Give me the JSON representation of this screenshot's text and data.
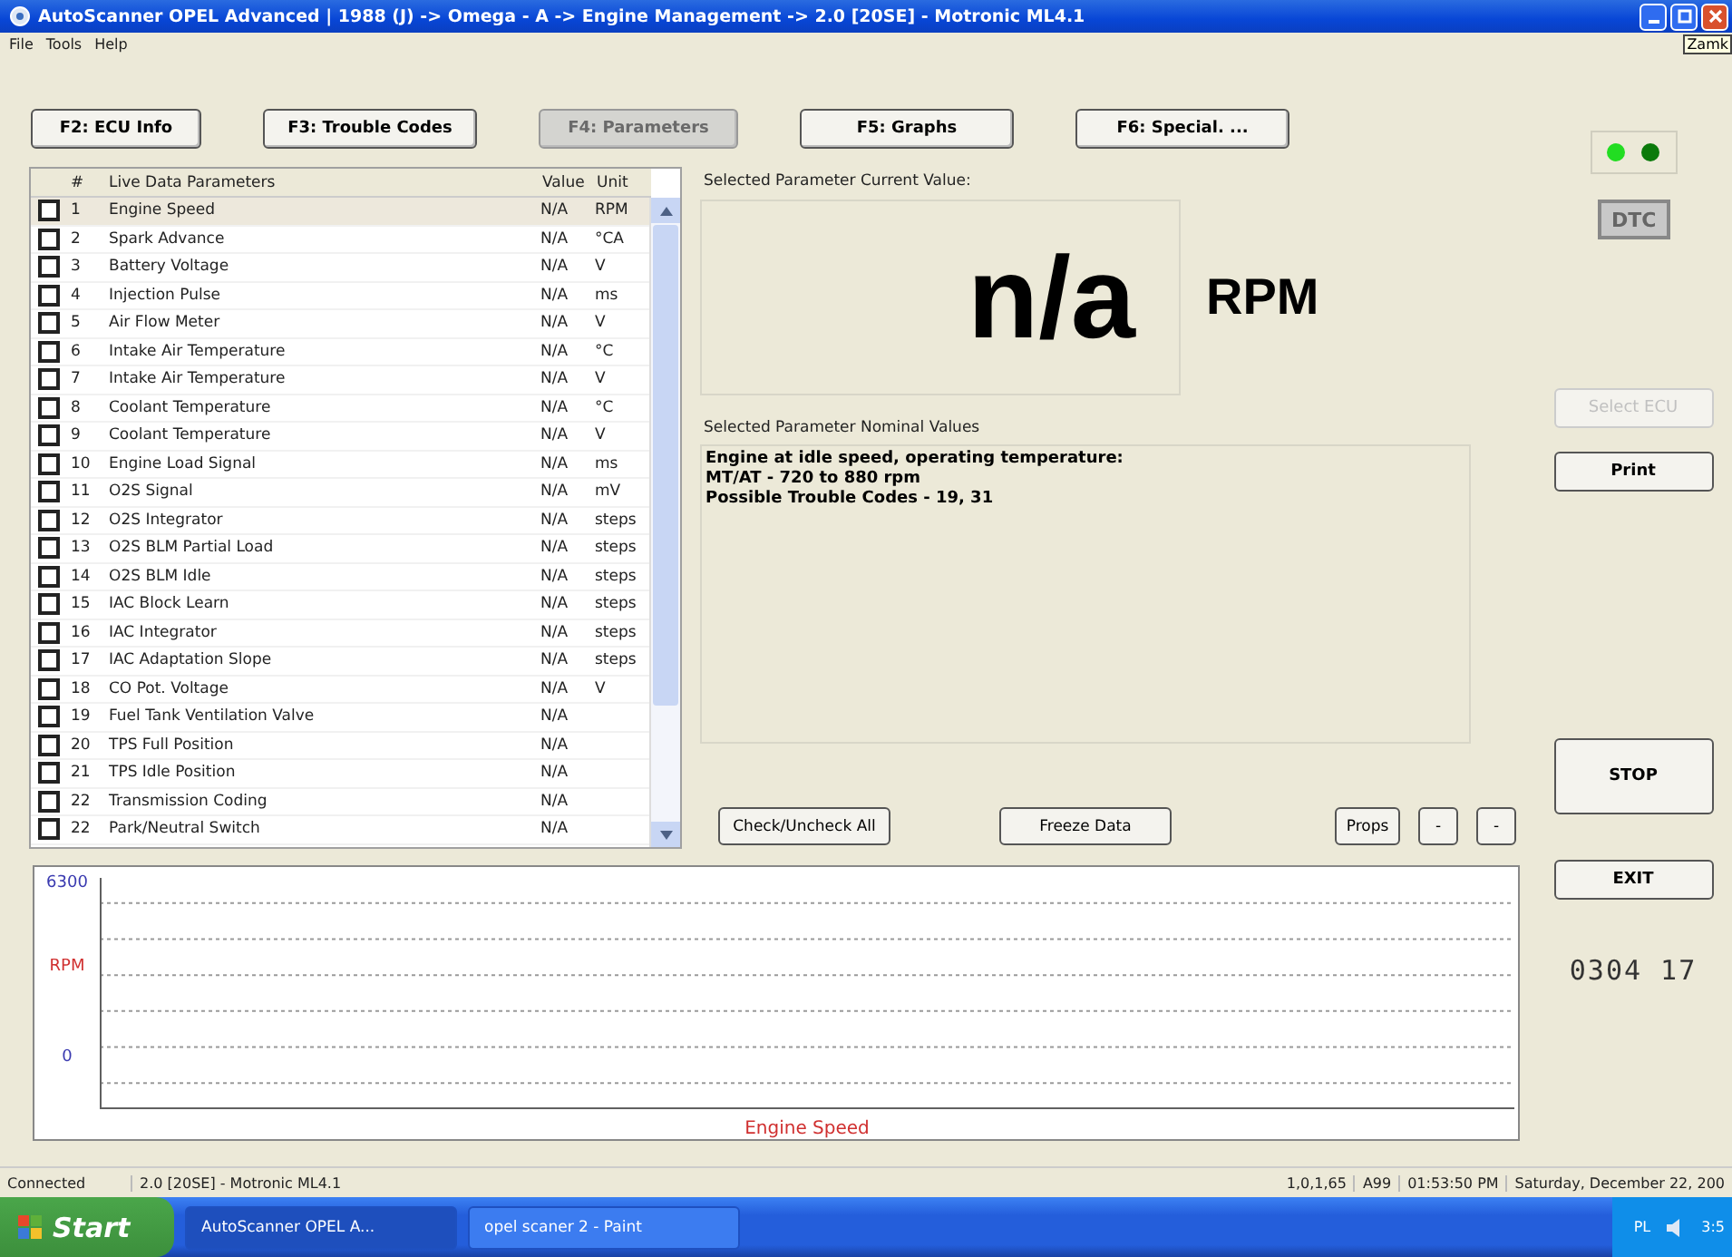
{
  "window": {
    "title": "AutoScanner OPEL Advanced | 1988 (J) -> Omega - A -> Engine Management -> 2.0 [20SE] - Motronic ML4.1",
    "tooltip": "Zamk"
  },
  "menu": [
    "File",
    "Tools",
    "Help"
  ],
  "tabs": [
    {
      "label": "F2:  ECU Info",
      "selected": false
    },
    {
      "label": "F3:  Trouble Codes",
      "selected": false
    },
    {
      "label": "F4:  Parameters",
      "selected": true
    },
    {
      "label": "F5:  Graphs",
      "selected": false
    },
    {
      "label": "F6:  Special. ...",
      "selected": false
    }
  ],
  "table": {
    "columns": [
      "#",
      "Live Data Parameters",
      "Value",
      "Unit"
    ],
    "rows": [
      {
        "num": "1",
        "name": "Engine Speed",
        "value": "N/A",
        "unit": "RPM",
        "checked": false,
        "selected": true
      },
      {
        "num": "2",
        "name": "Spark Advance",
        "value": "N/A",
        "unit": "°CA",
        "checked": false,
        "selected": false
      },
      {
        "num": "3",
        "name": "Battery Voltage",
        "value": "N/A",
        "unit": "V",
        "checked": false,
        "selected": false
      },
      {
        "num": "4",
        "name": "Injection Pulse",
        "value": "N/A",
        "unit": "ms",
        "checked": false,
        "selected": false
      },
      {
        "num": "5",
        "name": "Air Flow Meter",
        "value": "N/A",
        "unit": "V",
        "checked": false,
        "selected": false
      },
      {
        "num": "6",
        "name": "Intake Air Temperature",
        "value": "N/A",
        "unit": "°C",
        "checked": false,
        "selected": false
      },
      {
        "num": "7",
        "name": "Intake Air Temperature",
        "value": "N/A",
        "unit": "V",
        "checked": false,
        "selected": false
      },
      {
        "num": "8",
        "name": "Coolant Temperature",
        "value": "N/A",
        "unit": "°C",
        "checked": false,
        "selected": false
      },
      {
        "num": "9",
        "name": "Coolant Temperature",
        "value": "N/A",
        "unit": "V",
        "checked": false,
        "selected": false
      },
      {
        "num": "10",
        "name": "Engine Load Signal",
        "value": "N/A",
        "unit": "ms",
        "checked": false,
        "selected": false
      },
      {
        "num": "11",
        "name": "O2S Signal",
        "value": "N/A",
        "unit": "mV",
        "checked": false,
        "selected": false
      },
      {
        "num": "12",
        "name": "O2S Integrator",
        "value": "N/A",
        "unit": "steps",
        "checked": false,
        "selected": false
      },
      {
        "num": "13",
        "name": "O2S BLM Partial Load",
        "value": "N/A",
        "unit": "steps",
        "checked": false,
        "selected": false
      },
      {
        "num": "14",
        "name": "O2S BLM Idle",
        "value": "N/A",
        "unit": "steps",
        "checked": false,
        "selected": false
      },
      {
        "num": "15",
        "name": "IAC Block Learn",
        "value": "N/A",
        "unit": "steps",
        "checked": false,
        "selected": false
      },
      {
        "num": "16",
        "name": "IAC Integrator",
        "value": "N/A",
        "unit": "steps",
        "checked": false,
        "selected": false
      },
      {
        "num": "17",
        "name": "IAC Adaptation Slope",
        "value": "N/A",
        "unit": "steps",
        "checked": false,
        "selected": false
      },
      {
        "num": "18",
        "name": "CO Pot. Voltage",
        "value": "N/A",
        "unit": "V",
        "checked": false,
        "selected": false
      },
      {
        "num": "19",
        "name": "Fuel Tank Ventilation Valve",
        "value": "N/A",
        "checked": false,
        "selected": false
      },
      {
        "num": "20",
        "name": "TPS Full Position",
        "value": "N/A",
        "checked": false,
        "selected": false
      },
      {
        "num": "21",
        "name": "TPS Idle Position",
        "value": "N/A",
        "checked": false,
        "selected": false
      },
      {
        "num": "22",
        "name": "Transmission Coding",
        "value": "N/A",
        "checked": false,
        "selected": false
      },
      {
        "num": "22",
        "name": "Park/Neutral Switch",
        "value": "N/A",
        "checked": false,
        "selected": false
      }
    ]
  },
  "current": {
    "label": "Selected Parameter Current Value:",
    "value": "n/a",
    "unit": "RPM"
  },
  "nominal": {
    "label": "Selected Parameter Nominal Values",
    "lines": [
      "Engine at idle speed, operating temperature:",
      "MT/AT - 720 to 880 rpm",
      "Possible Trouble Codes - 19, 31"
    ]
  },
  "actions": [
    {
      "label": "Check/Uncheck All",
      "kind": "wide"
    },
    {
      "label": "Freeze Data",
      "kind": "wide"
    },
    {
      "label": "Props",
      "kind": "small"
    },
    {
      "label": "-",
      "kind": "tiny"
    },
    {
      "label": "-",
      "kind": "tiny"
    }
  ],
  "lights": [
    {
      "on": true
    },
    {
      "on": false
    }
  ],
  "side": {
    "dtc": {
      "label": "DTC",
      "disabled": true
    },
    "select_ecu": {
      "label": "Select ECU",
      "disabled": true
    },
    "print": "Print",
    "stop": "STOP",
    "exit": "EXIT",
    "counter": "0304 17"
  },
  "graph": {
    "y_max": "6300",
    "y_unit": "RPM",
    "y_min": "0",
    "title": "Engine Speed"
  },
  "status_bar": [
    "Connected",
    "2.0 [20SE] - Motronic ML4.1",
    "1,0,1,65",
    "A99",
    "01:53:50 PM",
    "Saturday, December 22, 200"
  ],
  "taskbar": {
    "start": "Start",
    "tasks": [
      {
        "label": "AutoScanner OPEL A...",
        "selected": true
      },
      {
        "label": "opel scaner 2 - Paint",
        "selected": false
      }
    ],
    "tray": [
      "PL",
      "3:5"
    ]
  }
}
